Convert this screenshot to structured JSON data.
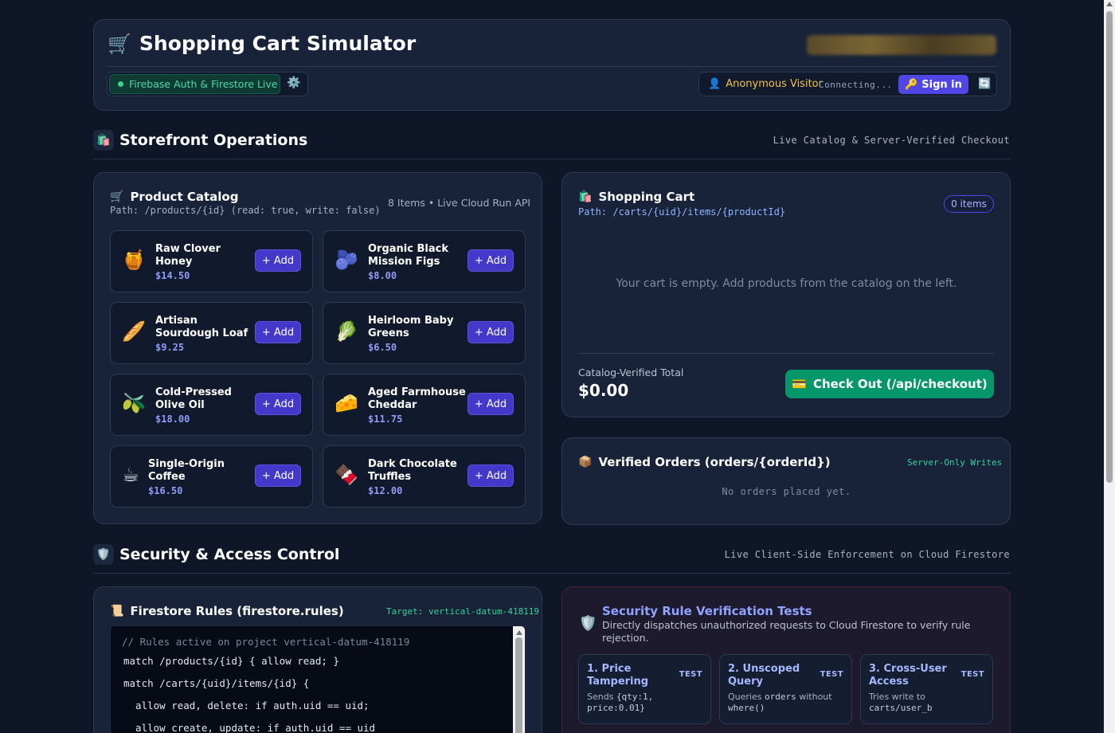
{
  "header": {
    "title": "Shopping Cart Simulator",
    "title_icon": "cart-icon",
    "status_label": "Firebase Auth & Firestore Live",
    "user_label": "Anonymous Visitor",
    "connecting_label": "Connecting...",
    "signin_label": "Sign in"
  },
  "storefront": {
    "title": "Storefront Operations",
    "subtitle": "Live Catalog & Server-Verified Checkout"
  },
  "catalog": {
    "title": "Product Catalog",
    "path": "Path: /products/{id} (read: true, write: false)",
    "meta": "8 Items • Live Cloud Run API",
    "add_label": "+ Add",
    "products": [
      {
        "emoji": "🍯",
        "name": "Raw Clover Honey",
        "price": "$14.50"
      },
      {
        "emoji": "🫐",
        "name": "Organic Black Mission Figs",
        "price": "$8.00"
      },
      {
        "emoji": "🥖",
        "name": "Artisan Sourdough Loaf",
        "price": "$9.25"
      },
      {
        "emoji": "🥬",
        "name": "Heirloom Baby Greens",
        "price": "$6.50"
      },
      {
        "emoji": "🫒",
        "name": "Cold-Pressed Olive Oil",
        "price": "$18.00"
      },
      {
        "emoji": "🧀",
        "name": "Aged Farmhouse Cheddar",
        "price": "$11.75"
      },
      {
        "emoji": "☕",
        "name": "Single-Origin Coffee",
        "price": "$16.50"
      },
      {
        "emoji": "🍫",
        "name": "Dark Chocolate Truffles",
        "price": "$12.00"
      }
    ]
  },
  "cart": {
    "title": "Shopping Cart",
    "path": "Path: /carts/{uid}/items/{productId}",
    "count_label": "0 items",
    "empty_message": "Your cart is empty. Add products from the catalog on the left.",
    "total_label": "Catalog-Verified Total",
    "total_value": "$0.00",
    "checkout_label": "Check Out (/api/checkout)"
  },
  "orders": {
    "title": "Verified Orders (orders/{orderId})",
    "badge": "Server-Only Writes",
    "empty_message": "No orders placed yet."
  },
  "security": {
    "title": "Security & Access Control",
    "subtitle": "Live Client-Side Enforcement on Cloud Firestore"
  },
  "rules": {
    "title": "Firestore Rules (firestore.rules)",
    "target": "Target: vertical-datum-418119",
    "code_lines": [
      "// Rules active on project vertical-datum-418119",
      "match /products/{id} { allow read; }",
      "match /carts/{uid}/items/{id} {",
      "  allow read, delete: if auth.uid == uid;",
      "  allow create, update: if auth.uid == uid"
    ]
  },
  "tests": {
    "title": "Security Rule Verification Tests",
    "subtitle": "Directly dispatches unauthorized requests to Cloud Firestore to verify rule rejection.",
    "badge": "TEST",
    "items": [
      {
        "name": "1. Price Tampering",
        "desc_a": "Sends ",
        "desc_code": "{qty:1, price:0.01}",
        "desc_b": ""
      },
      {
        "name": "2. Unscoped Query",
        "desc_a": "Queries ",
        "desc_code": "orders",
        "desc_b": " without ",
        "desc_code2": "where()"
      },
      {
        "name": "3. Cross-User Access",
        "desc_a": "Tries write to ",
        "desc_code": "carts/user_b",
        "desc_b": ""
      }
    ]
  }
}
